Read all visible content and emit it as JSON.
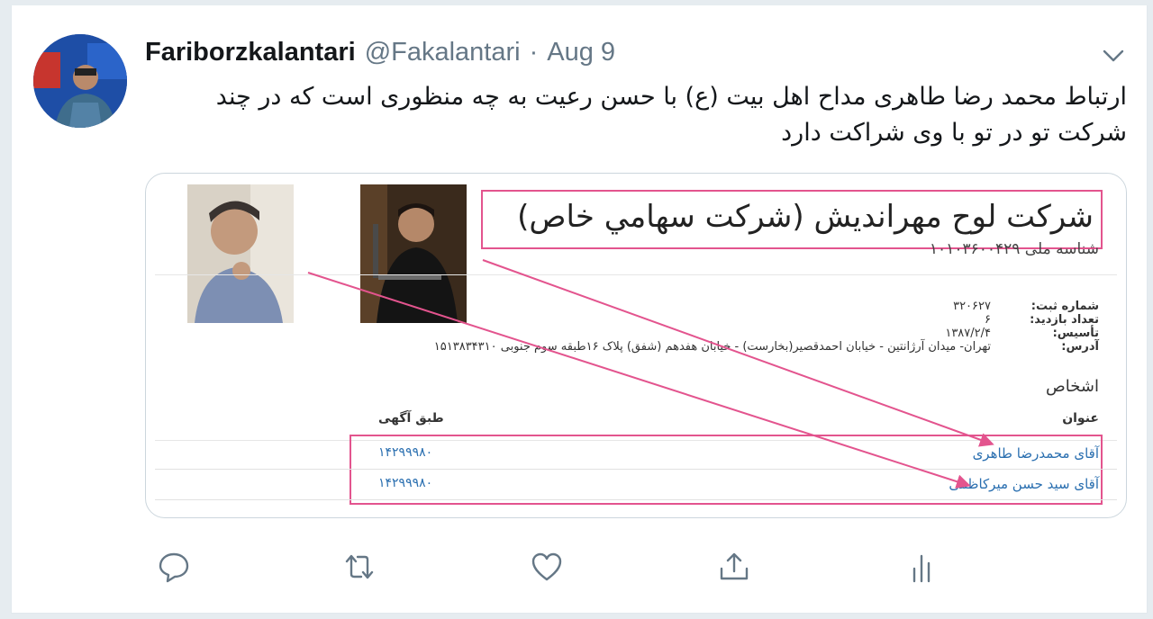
{
  "tweet": {
    "author_name": "Fariborzkalantari",
    "handle": "@Fakalantari",
    "separator": "·",
    "date": "Aug 9",
    "text": "ارتباط محمد رضا طاهری مداح اهل بیت (ع) با حسن رعیت به چه منظوری است که در چند شرکت تو در تو با وی شراکت دارد"
  },
  "card": {
    "company_name": "شركت لوح مهرانديش (شركت سهامي خاص)",
    "national_id": "شناسه ملی ۱۰۱۰۳۶۰۰۴۲۹",
    "info_labels": [
      "شماره ثبت:",
      "تعداد بازدید:",
      "تأسیس:",
      "آدرس:"
    ],
    "info_values": [
      "۳۲۰۶۲۷",
      "۶",
      "۱۳۸۷/۲/۴",
      "تهران- میدان آرژانتین - خیابان احمدقصیر(بخارست) - خیابان هفدهم (شفق) پلاک ۱۶طبقه سوم جنوبی ۱۵۱۳۸۳۴۳۱۰"
    ],
    "persons_title": "اشخاص",
    "col_title": "عنوان",
    "col_ref": "طبق آگهی",
    "persons": [
      {
        "name": "آقای محمدرضا طاهری",
        "ref": "۱۴۲۹۹۹۸۰"
      },
      {
        "name": "آقای سید حسن میرکاظمی",
        "ref": "۱۴۲۹۹۹۸۰"
      }
    ]
  },
  "colors": {
    "accent_pink": "#e3548e",
    "link_blue": "#2a6fb0",
    "muted": "#657786"
  },
  "icons": [
    "reply-icon",
    "retweet-icon",
    "like-icon",
    "share-icon",
    "analytics-icon",
    "chevron-down-icon"
  ]
}
